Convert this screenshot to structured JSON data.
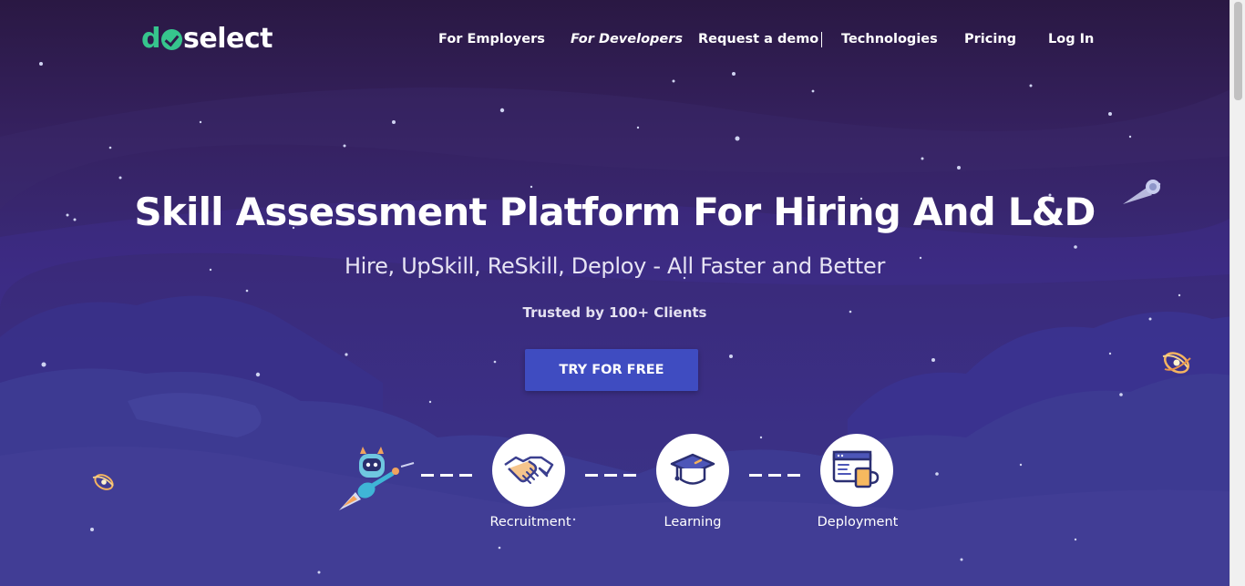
{
  "logo": {
    "part1": "d",
    "part2": "select"
  },
  "nav": {
    "items": [
      {
        "label": "For Employers"
      },
      {
        "label": "For Developers"
      },
      {
        "label": "Request a demo"
      },
      {
        "label": "Technologies"
      },
      {
        "label": "Pricing"
      },
      {
        "label": "Log In"
      }
    ]
  },
  "hero": {
    "title": "Skill Assessment Platform For Hiring And L&D",
    "subtitle": "Hire, UpSkill, ReSkill, Deploy - All Faster and Better",
    "trusted": "Trusted by 100+ Clients",
    "cta_label": "TRY FOR FREE"
  },
  "steps": [
    {
      "label": "Recruitment",
      "icon": "handshake-icon"
    },
    {
      "label": "Learning",
      "icon": "graduation-cap-icon"
    },
    {
      "label": "Deployment",
      "icon": "browser-coffee-icon"
    }
  ],
  "colors": {
    "brand_green": "#36c58d",
    "cta_blue": "#3f4cc1",
    "bg_top": "#2a1843",
    "bg_bottom": "#3a3686"
  }
}
